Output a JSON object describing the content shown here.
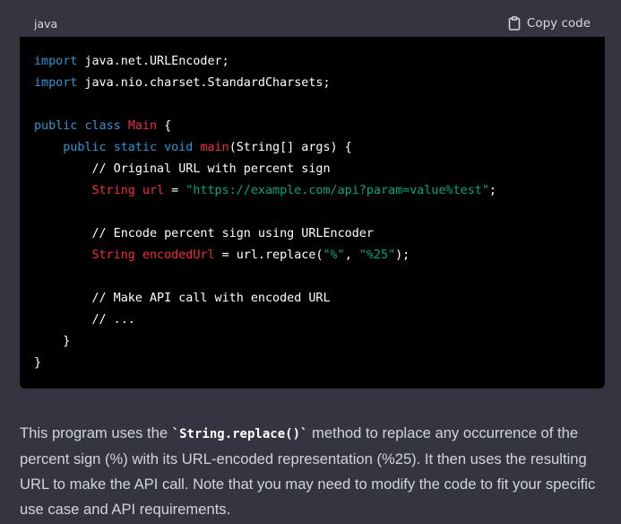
{
  "code_block": {
    "language": "java",
    "copy_label": "Copy code",
    "lines": [
      {
        "indent": "",
        "tokens": [
          {
            "t": "import",
            "c": "kw"
          },
          {
            "t": " java.net.URLEncoder;",
            "c": "plain"
          }
        ]
      },
      {
        "indent": "",
        "tokens": [
          {
            "t": "import",
            "c": "kw"
          },
          {
            "t": " java.nio.charset.StandardCharsets;",
            "c": "plain"
          }
        ]
      },
      {
        "indent": "",
        "tokens": []
      },
      {
        "indent": "",
        "tokens": [
          {
            "t": "public",
            "c": "kw"
          },
          {
            "t": " ",
            "c": "plain"
          },
          {
            "t": "class",
            "c": "kw"
          },
          {
            "t": " ",
            "c": "plain"
          },
          {
            "t": "Main",
            "c": "type"
          },
          {
            "t": " {",
            "c": "plain"
          }
        ]
      },
      {
        "indent": "    ",
        "tokens": [
          {
            "t": "public",
            "c": "kw"
          },
          {
            "t": " ",
            "c": "plain"
          },
          {
            "t": "static",
            "c": "kw"
          },
          {
            "t": " ",
            "c": "plain"
          },
          {
            "t": "void",
            "c": "kw"
          },
          {
            "t": " ",
            "c": "plain"
          },
          {
            "t": "main",
            "c": "type"
          },
          {
            "t": "(String[] args) {",
            "c": "plain"
          }
        ]
      },
      {
        "indent": "        ",
        "tokens": [
          {
            "t": "// Original URL with percent sign",
            "c": "cmt"
          }
        ]
      },
      {
        "indent": "        ",
        "tokens": [
          {
            "t": "String",
            "c": "type"
          },
          {
            "t": " ",
            "c": "plain"
          },
          {
            "t": "url",
            "c": "type"
          },
          {
            "t": " = ",
            "c": "plain"
          },
          {
            "t": "\"https://example.com/api?param=value%test\"",
            "c": "str"
          },
          {
            "t": ";",
            "c": "plain"
          }
        ]
      },
      {
        "indent": "",
        "tokens": []
      },
      {
        "indent": "        ",
        "tokens": [
          {
            "t": "// Encode percent sign using URLEncoder",
            "c": "cmt"
          }
        ]
      },
      {
        "indent": "        ",
        "tokens": [
          {
            "t": "String",
            "c": "type"
          },
          {
            "t": " ",
            "c": "plain"
          },
          {
            "t": "encodedUrl",
            "c": "type"
          },
          {
            "t": " = url.replace(",
            "c": "plain"
          },
          {
            "t": "\"%\"",
            "c": "str"
          },
          {
            "t": ", ",
            "c": "plain"
          },
          {
            "t": "\"%25\"",
            "c": "str"
          },
          {
            "t": ");",
            "c": "plain"
          }
        ]
      },
      {
        "indent": "",
        "tokens": []
      },
      {
        "indent": "        ",
        "tokens": [
          {
            "t": "// Make API call with encoded URL",
            "c": "cmt"
          }
        ]
      },
      {
        "indent": "        ",
        "tokens": [
          {
            "t": "// ...",
            "c": "cmt"
          }
        ]
      },
      {
        "indent": "    ",
        "tokens": [
          {
            "t": "}",
            "c": "plain"
          }
        ]
      },
      {
        "indent": "",
        "tokens": [
          {
            "t": "}",
            "c": "plain"
          }
        ]
      }
    ]
  },
  "description": {
    "before": "This program uses the ",
    "code": "`String.replace()`",
    "after": " method to replace any occurrence of the percent sign (%) with its URL-encoded representation (%25). It then uses the resulting URL to make the API call. Note that you may need to modify the code to fit your specific use case and API requirements."
  },
  "colors": {
    "page_bg": "#343541",
    "code_bg": "#000000",
    "header_bg": "#343541",
    "keyword": "#2e95d3",
    "type": "#f22c3d",
    "string": "#00a67d",
    "text": "#d1d5db"
  },
  "icons": {
    "copy": "clipboard-icon"
  }
}
